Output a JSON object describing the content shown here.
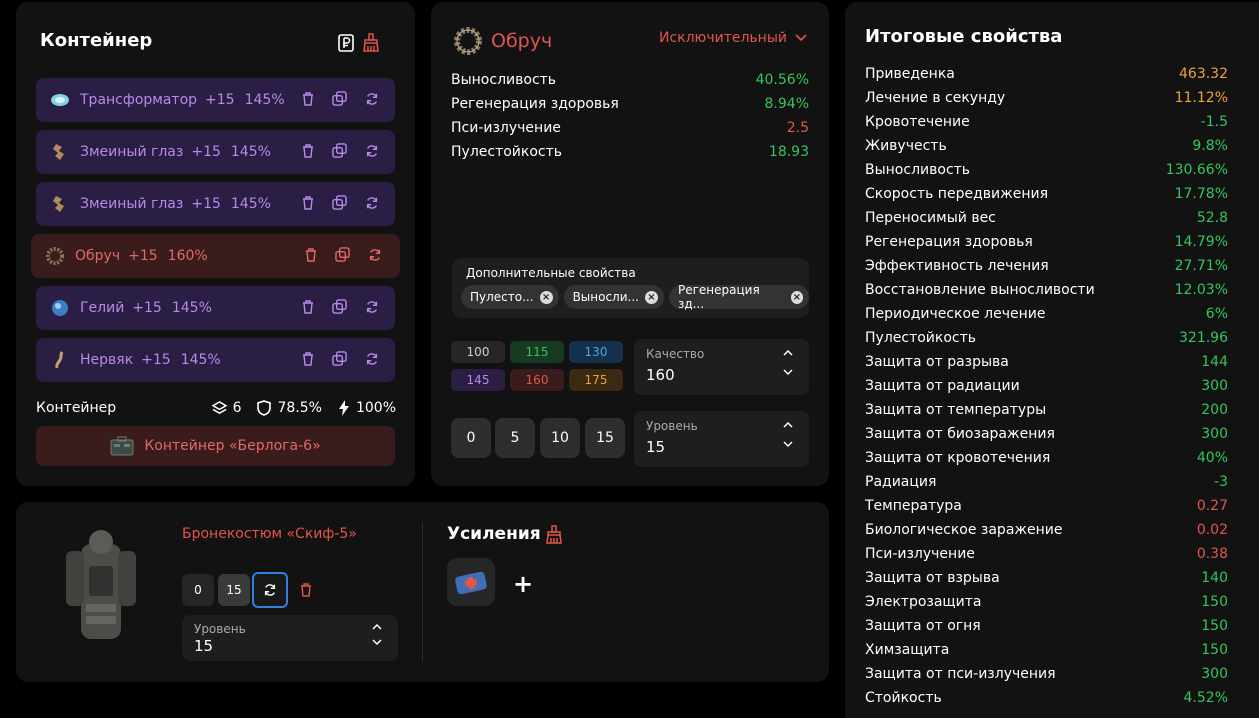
{
  "colors": {
    "green": "#35c55b",
    "orange": "#e9a33f",
    "red": "#e0554d",
    "purple": "#b58ae8"
  },
  "container": {
    "title": "Контейнер",
    "header_icons": [
      "ruble-document-icon",
      "broom-icon"
    ],
    "items": [
      {
        "name": "Трансформатор",
        "plus": "+15",
        "percent": "145%",
        "icon": "transformer-icon",
        "active": false
      },
      {
        "name": "Змеиный глаз",
        "plus": "+15",
        "percent": "145%",
        "icon": "snake-eye-icon",
        "active": false
      },
      {
        "name": "Змеиный глаз",
        "plus": "+15",
        "percent": "145%",
        "icon": "snake-eye-icon",
        "active": false
      },
      {
        "name": "Обруч",
        "plus": "+15",
        "percent": "160%",
        "icon": "hoop-icon",
        "active": true
      },
      {
        "name": "Гелий",
        "plus": "+15",
        "percent": "145%",
        "icon": "helium-icon",
        "active": false
      },
      {
        "name": "Нервяк",
        "plus": "+15",
        "percent": "145%",
        "icon": "nerve-icon",
        "active": false
      }
    ],
    "footer": {
      "label": "Контейнер",
      "slots": "6",
      "protection": "78.5%",
      "efficiency": "100%"
    },
    "container_name": "Контейнер «Берлога-6»"
  },
  "artifact": {
    "name": "Обруч",
    "rarity": "Исключительный",
    "properties": [
      {
        "label": "Выносливость",
        "value": "40.56%",
        "color": "#35c55b"
      },
      {
        "label": "Регенерация здоровья",
        "value": "8.94%",
        "color": "#35c55b"
      },
      {
        "label": "Пси-излучение",
        "value": "2.5",
        "color": "#e0554d"
      },
      {
        "label": "Пулестойкость",
        "value": "18.93",
        "color": "#35c55b"
      }
    ],
    "extra": {
      "label": "Дополнительные свойства",
      "chips": [
        "Пулесто...",
        "Выносли...",
        "Регенерация зд..."
      ]
    },
    "quality_buttons": [
      {
        "label": "100",
        "bg": "#262626",
        "fg": "#cfcfcf"
      },
      {
        "label": "115",
        "bg": "#173a22",
        "fg": "#35c55b"
      },
      {
        "label": "130",
        "bg": "#14304a",
        "fg": "#4ea3e8"
      },
      {
        "label": "145",
        "bg": "#2b1e45",
        "fg": "#b58ae8"
      },
      {
        "label": "160",
        "bg": "#3a1c1c",
        "fg": "#e0554d"
      },
      {
        "label": "175",
        "bg": "#3a2a12",
        "fg": "#e9a33f"
      }
    ],
    "quality": {
      "label": "Качество",
      "value": "160"
    },
    "level_buttons": [
      "0",
      "5",
      "10",
      "15"
    ],
    "level": {
      "label": "Уровень",
      "value": "15"
    }
  },
  "armor": {
    "name": "Бронекостюм «Скиф-5»",
    "buttons": [
      "0",
      "15"
    ],
    "level": {
      "label": "Уровень",
      "value": "15"
    },
    "boosts_title": "Усиления",
    "add_label": "+"
  },
  "totals": {
    "title": "Итоговые свойства",
    "rows": [
      {
        "label": "Приведенка",
        "value": "463.32",
        "color": "#e9a33f"
      },
      {
        "label": "Лечение в секунду",
        "value": "11.12%",
        "color": "#e9a33f"
      },
      {
        "label": "Кровотечение",
        "value": "-1.5",
        "color": "#35c55b"
      },
      {
        "label": "Живучесть",
        "value": "9.8%",
        "color": "#35c55b"
      },
      {
        "label": "Выносливость",
        "value": "130.66%",
        "color": "#35c55b"
      },
      {
        "label": "Скорость передвижения",
        "value": "17.78%",
        "color": "#35c55b"
      },
      {
        "label": "Переносимый вес",
        "value": "52.8",
        "color": "#35c55b"
      },
      {
        "label": "Регенерация здоровья",
        "value": "14.79%",
        "color": "#35c55b"
      },
      {
        "label": "Эффективность лечения",
        "value": "27.71%",
        "color": "#35c55b"
      },
      {
        "label": "Восстановление выносливости",
        "value": "12.03%",
        "color": "#35c55b"
      },
      {
        "label": "Периодическое лечение",
        "value": "6%",
        "color": "#35c55b"
      },
      {
        "label": "Пулестойкость",
        "value": "321.96",
        "color": "#35c55b"
      },
      {
        "label": "Защита от разрыва",
        "value": "144",
        "color": "#35c55b"
      },
      {
        "label": "Защита от радиации",
        "value": "300",
        "color": "#35c55b"
      },
      {
        "label": "Защита от температуры",
        "value": "200",
        "color": "#35c55b"
      },
      {
        "label": "Защита от биозаражения",
        "value": "300",
        "color": "#35c55b"
      },
      {
        "label": "Защита от кровотечения",
        "value": "40%",
        "color": "#35c55b"
      },
      {
        "label": "Радиация",
        "value": "-3",
        "color": "#35c55b"
      },
      {
        "label": "Температура",
        "value": "0.27",
        "color": "#e0554d"
      },
      {
        "label": "Биологическое заражение",
        "value": "0.02",
        "color": "#e0554d"
      },
      {
        "label": "Пси-излучение",
        "value": "0.38",
        "color": "#e0554d"
      },
      {
        "label": "Защита от взрыва",
        "value": "140",
        "color": "#35c55b"
      },
      {
        "label": "Электрозащита",
        "value": "150",
        "color": "#35c55b"
      },
      {
        "label": "Защита от огня",
        "value": "150",
        "color": "#35c55b"
      },
      {
        "label": "Химзащита",
        "value": "150",
        "color": "#35c55b"
      },
      {
        "label": "Защита от пси-излучения",
        "value": "300",
        "color": "#35c55b"
      },
      {
        "label": "Стойкость",
        "value": "4.52%",
        "color": "#35c55b"
      }
    ]
  }
}
